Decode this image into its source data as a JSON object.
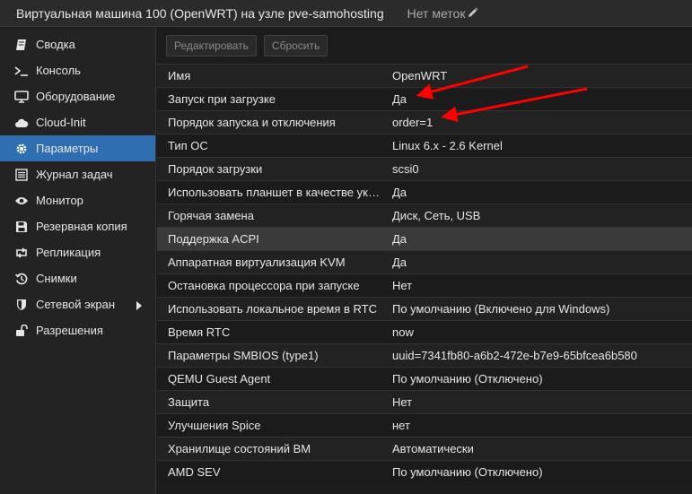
{
  "header": {
    "title": "Виртуальная машина 100 (OpenWRT) на узле pve-samohosting",
    "tags_label": "Нет меток",
    "tags_icon": "pencil-icon"
  },
  "sidebar": {
    "items": [
      {
        "label": "Сводка",
        "icon": "book-icon"
      },
      {
        "label": "Консоль",
        "icon": "terminal-icon"
      },
      {
        "label": "Оборудование",
        "icon": "desktop-icon"
      },
      {
        "label": "Cloud-Init",
        "icon": "cloud-icon"
      },
      {
        "label": "Параметры",
        "icon": "gear-icon",
        "active": true
      },
      {
        "label": "Журнал задач",
        "icon": "list-icon"
      },
      {
        "label": "Монитор",
        "icon": "eye-icon"
      },
      {
        "label": "Резервная копия",
        "icon": "floppy-icon"
      },
      {
        "label": "Репликация",
        "icon": "retweet-icon"
      },
      {
        "label": "Снимки",
        "icon": "history-icon"
      },
      {
        "label": "Сетевой экран",
        "icon": "shield-icon",
        "has_submenu": true
      },
      {
        "label": "Разрешения",
        "icon": "unlock-icon"
      }
    ]
  },
  "toolbar": {
    "edit_label": "Редактировать",
    "reset_label": "Сбросить"
  },
  "options": {
    "rows": [
      {
        "key": "Имя",
        "value": "OpenWRT"
      },
      {
        "key": "Запуск при загрузке",
        "value": "Да"
      },
      {
        "key": "Порядок запуска и отключения",
        "value": "order=1"
      },
      {
        "key": "Тип ОС",
        "value": "Linux 6.x - 2.6 Kernel"
      },
      {
        "key": "Порядок загрузки",
        "value": "scsi0"
      },
      {
        "key": "Использовать планшет в качестве указателя",
        "value": "Да"
      },
      {
        "key": "Горячая замена",
        "value": "Диск, Сеть, USB"
      },
      {
        "key": "Поддержка ACPI",
        "value": "Да",
        "selected": true
      },
      {
        "key": "Аппаратная виртуализация KVM",
        "value": "Да"
      },
      {
        "key": "Остановка процессора при запуске",
        "value": "Нет"
      },
      {
        "key": "Использовать локальное время в RTC",
        "value": "По умолчанию (Включено для Windows)"
      },
      {
        "key": "Время RTC",
        "value": "now"
      },
      {
        "key": "Параметры SMBIOS (type1)",
        "value": "uuid=7341fb80-a6b2-472e-b7e9-65bfcea6b580"
      },
      {
        "key": "QEMU Guest Agent",
        "value": "По умолчанию (Отключено)"
      },
      {
        "key": "Защита",
        "value": "Нет"
      },
      {
        "key": "Улучшения Spice",
        "value": "нет"
      },
      {
        "key": "Хранилище состояний ВМ",
        "value": "Автоматически"
      },
      {
        "key": "AMD SEV",
        "value": "По умолчанию (Отключено)"
      }
    ]
  },
  "annotation": {
    "arrow_color": "#ff0000"
  }
}
